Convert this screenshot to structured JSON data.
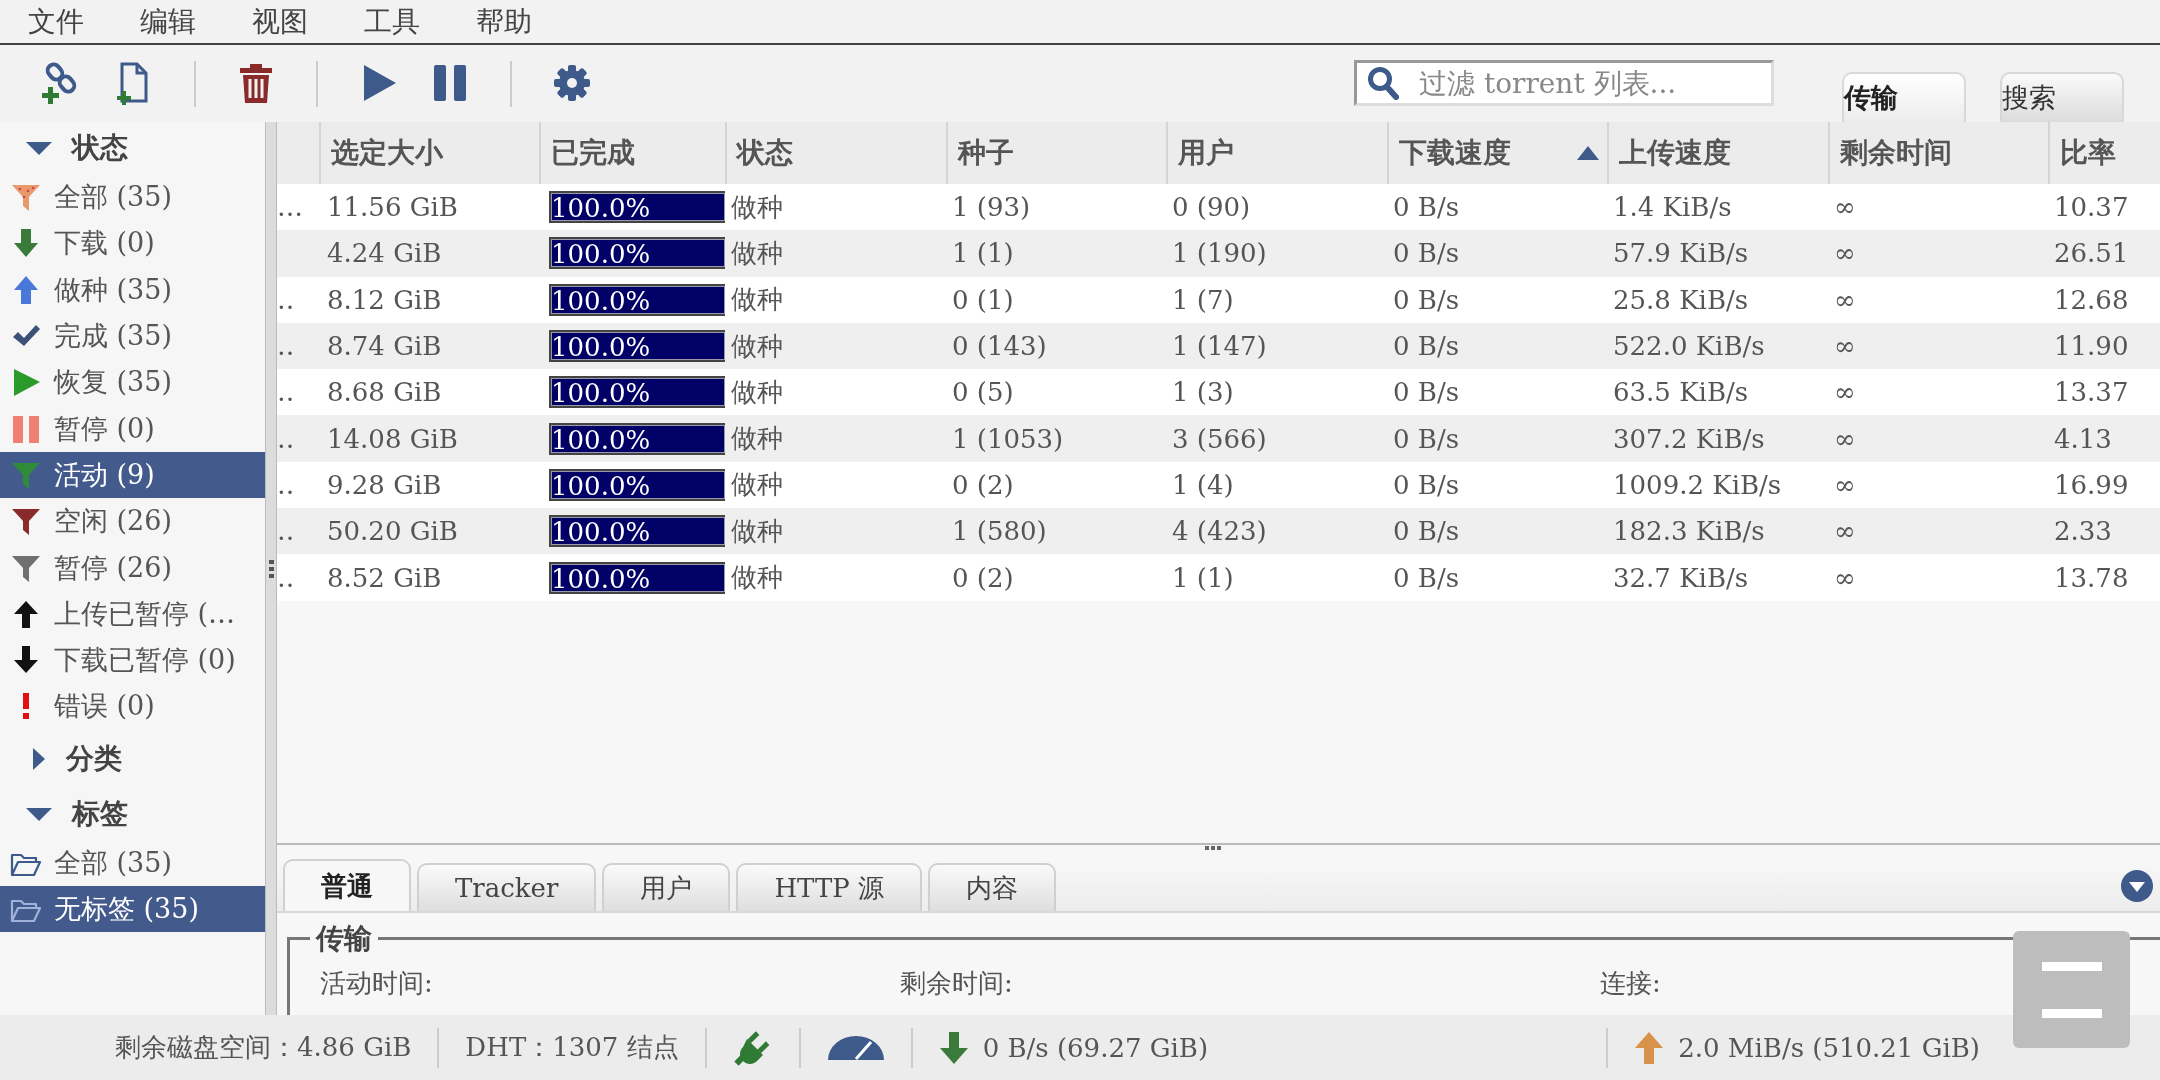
{
  "menu": [
    "文件",
    "编辑",
    "视图",
    "工具",
    "帮助"
  ],
  "toolbar": [
    {
      "kind": "add-link"
    },
    {
      "kind": "add-file"
    },
    {
      "kind": "separator"
    },
    {
      "kind": "delete"
    },
    {
      "kind": "separator"
    },
    {
      "kind": "resume"
    },
    {
      "kind": "pause"
    },
    {
      "kind": "separator"
    },
    {
      "kind": "settings"
    }
  ],
  "search": {
    "placeholder": "过滤 torrent 列表..."
  },
  "view_tabs": [
    {
      "label": "传输",
      "selected": true
    },
    {
      "label": "搜索",
      "selected": false
    }
  ],
  "sidebar": [
    {
      "title": "状态",
      "expanded": true,
      "items": [
        {
          "label": "全部 (35)",
          "kind": "filter-all",
          "selected": false
        },
        {
          "label": "下载 (0)",
          "kind": "downloading",
          "selected": false
        },
        {
          "label": "做种 (35)",
          "kind": "seeding",
          "selected": false
        },
        {
          "label": "完成 (35)",
          "kind": "completed",
          "selected": false
        },
        {
          "label": "恢复 (35)",
          "kind": "resumed",
          "selected": false
        },
        {
          "label": "暂停 (0)",
          "kind": "paused",
          "selected": false
        },
        {
          "label": "活动 (9)",
          "kind": "active",
          "selected": true
        },
        {
          "label": "空闲 (26)",
          "kind": "inactive",
          "selected": false
        },
        {
          "label": "暂停 (26)",
          "kind": "stalled",
          "selected": false
        },
        {
          "label": "上传已暂停 (…",
          "kind": "up-paused",
          "selected": false
        },
        {
          "label": "下载已暂停 (0)",
          "kind": "down-paused",
          "selected": false
        },
        {
          "label": "错误 (0)",
          "kind": "error",
          "selected": false
        }
      ]
    },
    {
      "title": "分类",
      "expanded": false
    },
    {
      "title": "标签",
      "expanded": true,
      "items": [
        {
          "label": "全部 (35)",
          "kind": "folder",
          "selected": false
        },
        {
          "label": "无标签 (35)",
          "kind": "folder",
          "selected": true
        }
      ]
    }
  ],
  "table": {
    "columns": [
      {
        "label": "选定大小",
        "sorted": false
      },
      {
        "label": "已完成",
        "sorted": false
      },
      {
        "label": "状态",
        "sorted": false
      },
      {
        "label": "种子",
        "sorted": false
      },
      {
        "label": "用户",
        "sorted": false
      },
      {
        "label": "下载速度",
        "sorted": true
      },
      {
        "label": "上传速度",
        "sorted": false
      },
      {
        "label": "剩余时间",
        "sorted": false
      },
      {
        "label": "比率",
        "sorted": false
      }
    ],
    "rows": [
      {
        "name": "…",
        "size": "11.56 GiB",
        "progress": {
          "level": 1,
          "text": "100.0%"
        },
        "status": "做种",
        "seeds": "1 (93)",
        "peers": "0 (90)",
        "down": "0 B/s",
        "up": "1.4 KiB/s",
        "eta": "∞",
        "ratio": "10.37"
      },
      {
        "size": "4.24 GiB",
        "progress": {
          "level": 1,
          "text": "100.0%"
        },
        "status": "做种",
        "seeds": "1 (1)",
        "peers": "1 (190)",
        "down": "0 B/s",
        "up": "57.9 KiB/s",
        "eta": "∞",
        "ratio": "26.51"
      },
      {
        "name": "‥",
        "size": "8.12 GiB",
        "progress": {
          "level": 1,
          "text": "100.0%"
        },
        "status": "做种",
        "seeds": "0 (1)",
        "peers": "1 (7)",
        "down": "0 B/s",
        "up": "25.8 KiB/s",
        "eta": "∞",
        "ratio": "12.68"
      },
      {
        "name": "‥",
        "size": "8.74 GiB",
        "progress": {
          "level": 1,
          "text": "100.0%"
        },
        "status": "做种",
        "seeds": "0 (143)",
        "peers": "1 (147)",
        "down": "0 B/s",
        "up": "522.0 KiB/s",
        "eta": "∞",
        "ratio": "11.90"
      },
      {
        "name": "‥",
        "size": "8.68 GiB",
        "progress": {
          "level": 1,
          "text": "100.0%"
        },
        "status": "做种",
        "seeds": "0 (5)",
        "peers": "1 (3)",
        "down": "0 B/s",
        "up": "63.5 KiB/s",
        "eta": "∞",
        "ratio": "13.37"
      },
      {
        "name": "‥",
        "size": "14.08 GiB",
        "progress": {
          "level": 1,
          "text": "100.0%"
        },
        "status": "做种",
        "seeds": "1 (1053)",
        "peers": "3 (566)",
        "down": "0 B/s",
        "up": "307.2 KiB/s",
        "eta": "∞",
        "ratio": "4.13"
      },
      {
        "name": "‥",
        "size": "9.28 GiB",
        "progress": {
          "level": 1,
          "text": "100.0%"
        },
        "status": "做种",
        "seeds": "0 (2)",
        "peers": "1 (4)",
        "down": "0 B/s",
        "up": "1009.2 KiB/s",
        "eta": "∞",
        "ratio": "16.99"
      },
      {
        "name": "‥",
        "size": "50.20 GiB",
        "progress": {
          "level": 1,
          "text": "100.0%"
        },
        "status": "做种",
        "seeds": "1 (580)",
        "peers": "4 (423)",
        "down": "0 B/s",
        "up": "182.3 KiB/s",
        "eta": "∞",
        "ratio": "2.33"
      },
      {
        "name": "‥",
        "size": "8.52 GiB",
        "progress": {
          "level": 1,
          "text": "100.0%"
        },
        "status": "做种",
        "seeds": "0 (2)",
        "peers": "1 (1)",
        "down": "0 B/s",
        "up": "32.7 KiB/s",
        "eta": "∞",
        "ratio": "13.78"
      }
    ]
  },
  "details": {
    "tabs": [
      {
        "label": "普通",
        "selected": true
      },
      {
        "label": "Tracker",
        "selected": false
      },
      {
        "label": "用户",
        "selected": false
      },
      {
        "label": "HTTP 源",
        "selected": false
      },
      {
        "label": "内容",
        "selected": false
      }
    ],
    "group": {
      "title": "传输",
      "fields": [
        "活动时间:",
        "剩余时间:",
        "连接:"
      ]
    }
  },
  "status_bar": {
    "free_space": "剩余磁盘空间：4.86 GiB",
    "dht": "DHT：1307 结点",
    "download": "0 B/s (69.27 GiB)",
    "upload": "2.0 MiB/s (510.21 GiB)"
  }
}
